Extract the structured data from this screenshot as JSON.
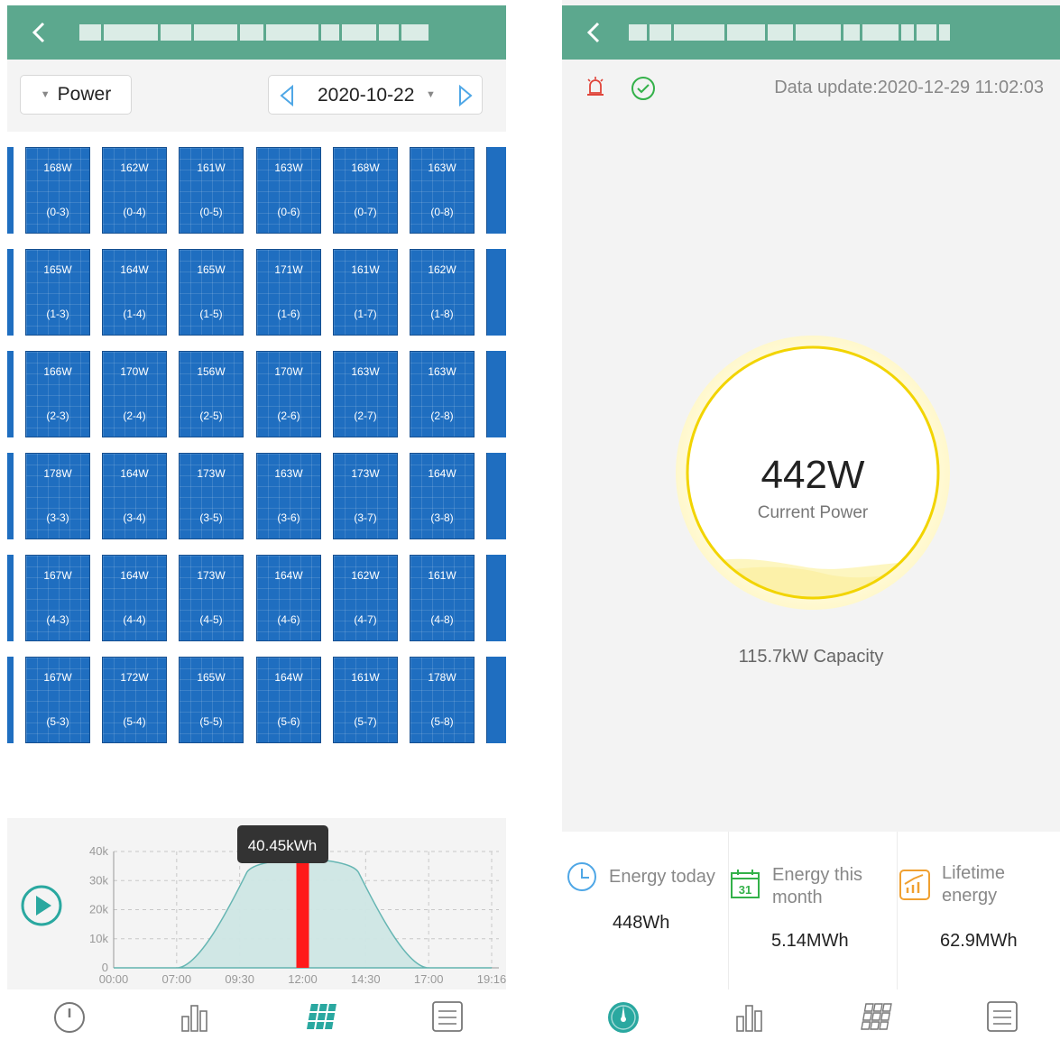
{
  "left_screen": {
    "header": {
      "title": ""
    },
    "toolbar": {
      "metric_label": "Power",
      "date": "2020-10-22"
    },
    "panels": [
      [
        {
          "power": "168W",
          "id": "(0-3)"
        },
        {
          "power": "162W",
          "id": "(0-4)"
        },
        {
          "power": "161W",
          "id": "(0-5)"
        },
        {
          "power": "163W",
          "id": "(0-6)"
        },
        {
          "power": "168W",
          "id": "(0-7)"
        },
        {
          "power": "163W",
          "id": "(0-8)"
        }
      ],
      [
        {
          "power": "165W",
          "id": "(1-3)"
        },
        {
          "power": "164W",
          "id": "(1-4)"
        },
        {
          "power": "165W",
          "id": "(1-5)"
        },
        {
          "power": "171W",
          "id": "(1-6)"
        },
        {
          "power": "161W",
          "id": "(1-7)"
        },
        {
          "power": "162W",
          "id": "(1-8)"
        }
      ],
      [
        {
          "power": "166W",
          "id": "(2-3)"
        },
        {
          "power": "170W",
          "id": "(2-4)"
        },
        {
          "power": "156W",
          "id": "(2-5)"
        },
        {
          "power": "170W",
          "id": "(2-6)"
        },
        {
          "power": "163W",
          "id": "(2-7)"
        },
        {
          "power": "163W",
          "id": "(2-8)"
        }
      ],
      [
        {
          "power": "178W",
          "id": "(3-3)"
        },
        {
          "power": "164W",
          "id": "(3-4)"
        },
        {
          "power": "173W",
          "id": "(3-5)"
        },
        {
          "power": "163W",
          "id": "(3-6)"
        },
        {
          "power": "173W",
          "id": "(3-7)"
        },
        {
          "power": "164W",
          "id": "(3-8)"
        }
      ],
      [
        {
          "power": "167W",
          "id": "(4-3)"
        },
        {
          "power": "164W",
          "id": "(4-4)"
        },
        {
          "power": "173W",
          "id": "(4-5)"
        },
        {
          "power": "164W",
          "id": "(4-6)"
        },
        {
          "power": "162W",
          "id": "(4-7)"
        },
        {
          "power": "161W",
          "id": "(4-8)"
        }
      ],
      [
        {
          "power": "167W",
          "id": "(5-3)"
        },
        {
          "power": "172W",
          "id": "(5-4)"
        },
        {
          "power": "165W",
          "id": "(5-5)"
        },
        {
          "power": "164W",
          "id": "(5-6)"
        },
        {
          "power": "161W",
          "id": "(5-7)"
        },
        {
          "power": "178W",
          "id": "(5-8)"
        }
      ]
    ],
    "chart": {
      "tooltip": "40.45kWh",
      "y_ticks": [
        "40k",
        "30k",
        "20k",
        "10k",
        "0"
      ],
      "x_ticks": [
        "00:00",
        "07:00",
        "09:30",
        "12:00",
        "14:30",
        "17:00",
        "19:16"
      ],
      "selected_tick": "12:00"
    },
    "nav": [
      "dashboard-icon",
      "bar-chart-icon",
      "panels-icon",
      "list-icon"
    ],
    "active_nav": "panels-icon"
  },
  "right_screen": {
    "header": {
      "title": ""
    },
    "update_text": "Data update:2020-12-29 11:02:03",
    "current_power": "442W",
    "current_power_label": "Current Power",
    "capacity": "115.7kW Capacity",
    "stats": {
      "today_label": "Energy today",
      "today_value": "448Wh",
      "month_label": "Energy this month",
      "month_value": "5.14MWh",
      "calendar_day": "31",
      "lifetime_label": "Lifetime energy",
      "lifetime_value": "62.9MWh"
    },
    "active_nav": "dashboard-icon"
  },
  "colors": {
    "header": "#5ca88e",
    "panel": "#1f6ec0",
    "accent": "#2aa8a0",
    "gauge": "#f2d400",
    "selection": "#ff0000"
  },
  "chart_data": {
    "type": "area",
    "title": "",
    "x": [
      "00:00",
      "07:00",
      "09:30",
      "12:00",
      "14:30",
      "17:00",
      "19:16"
    ],
    "series": [
      {
        "values": [
          0,
          0,
          31000,
          40450,
          31000,
          0,
          0
        ]
      }
    ],
    "ylim": [
      0,
      40000
    ],
    "y_ticks": [
      0,
      10000,
      20000,
      30000,
      40000
    ],
    "selected": {
      "x": "12:00",
      "label": "40.45kWh"
    },
    "grid": true
  }
}
